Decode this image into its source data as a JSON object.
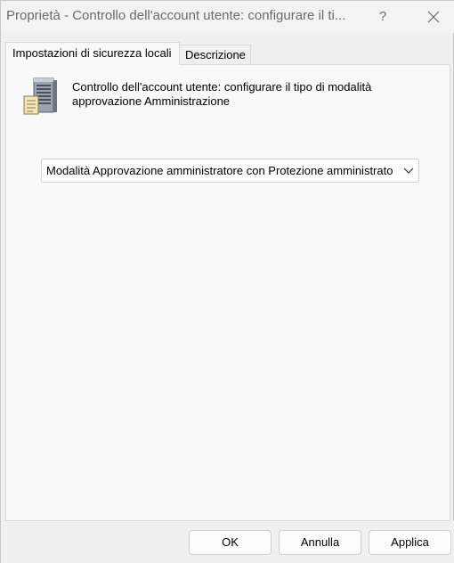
{
  "window": {
    "title": "Proprietà - Controllo dell'account utente: configurare il ti...",
    "help_label": "?"
  },
  "tabs": [
    {
      "label": "Impostazioni di sicurezza locali",
      "active": true
    },
    {
      "label": "Descrizione",
      "active": false
    }
  ],
  "policy": {
    "icon": "server-policy-icon",
    "description": "Controllo dell'account utente: configurare il tipo di modalità approvazione Amministrazione"
  },
  "setting": {
    "selected_value": "Modalità Approvazione amministratore con Protezione amministrato"
  },
  "buttons": {
    "ok": "OK",
    "cancel": "Annulla",
    "apply": "Applica"
  }
}
